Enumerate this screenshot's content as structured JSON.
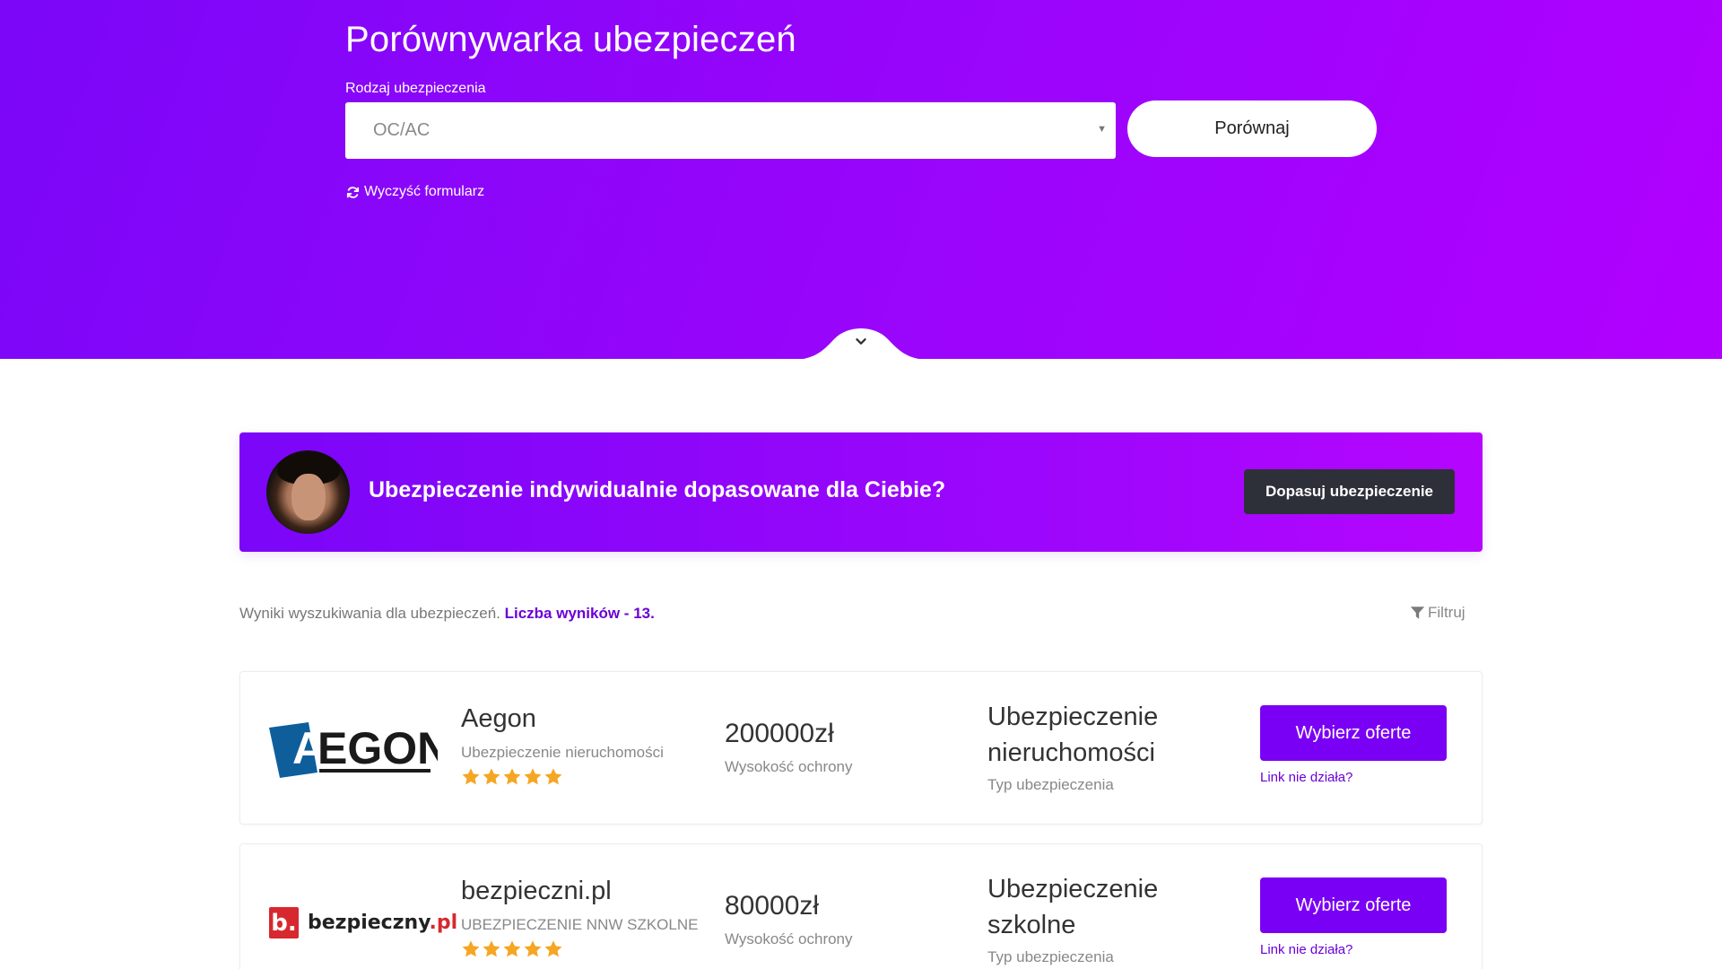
{
  "hero": {
    "title": "Porównywarka ubezpieczeń",
    "select_label": "Rodzaj ubezpieczenia",
    "select_value": "OC/AC",
    "compare_button": "Porównaj",
    "clear_form": "Wyczyść formularz"
  },
  "promo": {
    "text": "Ubezpieczenie indywidualnie dopasowane dla Ciebie?",
    "button": "Dopasuj ubezpieczenie"
  },
  "results": {
    "meta_text": "Wyniki wyszukiwania dla ubezpieczeń.",
    "count_text": "Liczba wyników - 13.",
    "filter_label": "Filtruj"
  },
  "offers": [
    {
      "logo_text": "AEGON",
      "company": "Aegon",
      "subtitle": "Ubezpieczenie nieruchomości",
      "rating": 5,
      "amount": "200000zł",
      "amount_label": "Wysokość ochrony",
      "type": "Ubezpieczenie nieruchomości",
      "type_label": "Typ ubezpieczenia",
      "button": "Wybierz oferte",
      "broken_link": "Link nie działa?"
    },
    {
      "logo_text": "bezpieczny.pl",
      "logo_letter": "b.",
      "logo_main": "bezpieczny",
      "logo_suffix": ".pl",
      "company": "bezpieczni.pl",
      "subtitle": "UBEZPIECZENIE NNW SZKOLNE",
      "rating": 5,
      "amount": "80000zł",
      "amount_label": "Wysokość ochrony",
      "type": "Ubezpieczenie szkolne",
      "type_label": "Typ ubezpieczenia",
      "button": "Wybierz oferte",
      "broken_link": "Link nie działa?"
    }
  ],
  "colors": {
    "gradient_start": "#7b06f8",
    "gradient_end": "#b100ff",
    "accent_button": "#7a00f5",
    "dark_button": "#2d3039",
    "star": "#f5a623",
    "link": "#6a00d8"
  }
}
